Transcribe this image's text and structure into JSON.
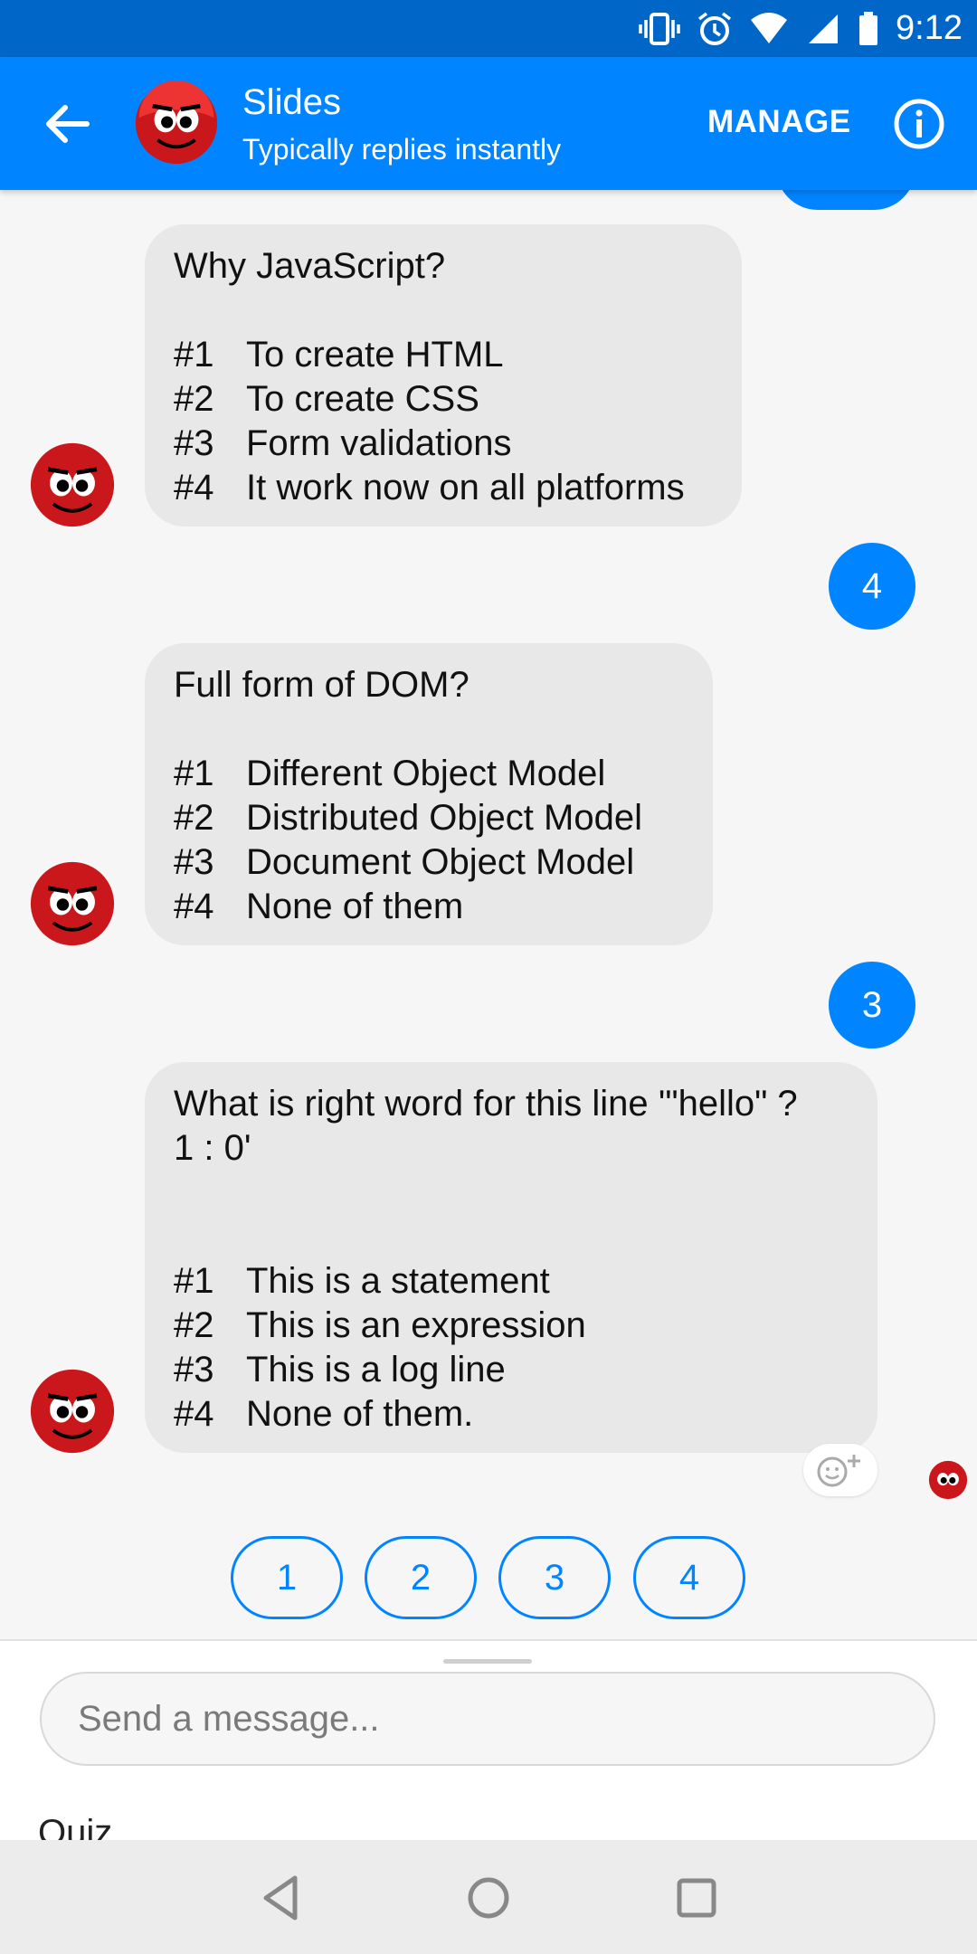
{
  "status_bar": {
    "time": "9:12"
  },
  "header": {
    "title": "Slides",
    "subtitle": "Typically replies instantly",
    "manage_label": "MANAGE"
  },
  "messages": [
    {
      "question": "Why JavaScript?",
      "options": [
        {
          "num": "#1",
          "text": "To create HTML"
        },
        {
          "num": "#2",
          "text": "To create CSS"
        },
        {
          "num": "#3",
          "text": "Form validations"
        },
        {
          "num": "#4",
          "text": "It work now on all platforms"
        }
      ],
      "reply": "4"
    },
    {
      "question": "Full form of DOM?",
      "options": [
        {
          "num": "#1",
          "text": "Different Object Model"
        },
        {
          "num": "#2",
          "text": "Distributed Object Model"
        },
        {
          "num": "#3",
          "text": "Document Object Model"
        },
        {
          "num": "#4",
          "text": "None of them"
        }
      ],
      "reply": "3"
    },
    {
      "question": "What is right word for this line '\"hello\" ?\n1 : 0'",
      "options": [
        {
          "num": "#1",
          "text": "This is a statement"
        },
        {
          "num": "#2",
          "text": "This is an expression"
        },
        {
          "num": "#3",
          "text": "This is a log line"
        },
        {
          "num": "#4",
          "text": "None of them."
        }
      ]
    }
  ],
  "quick_replies": [
    "1",
    "2",
    "3",
    "4"
  ],
  "composer": {
    "placeholder": "Send a message...",
    "menu_label": "Quiz"
  },
  "colors": {
    "accent": "#0084ff",
    "status_bar": "#0067c9",
    "bot_bubble": "#e8e8e8"
  }
}
